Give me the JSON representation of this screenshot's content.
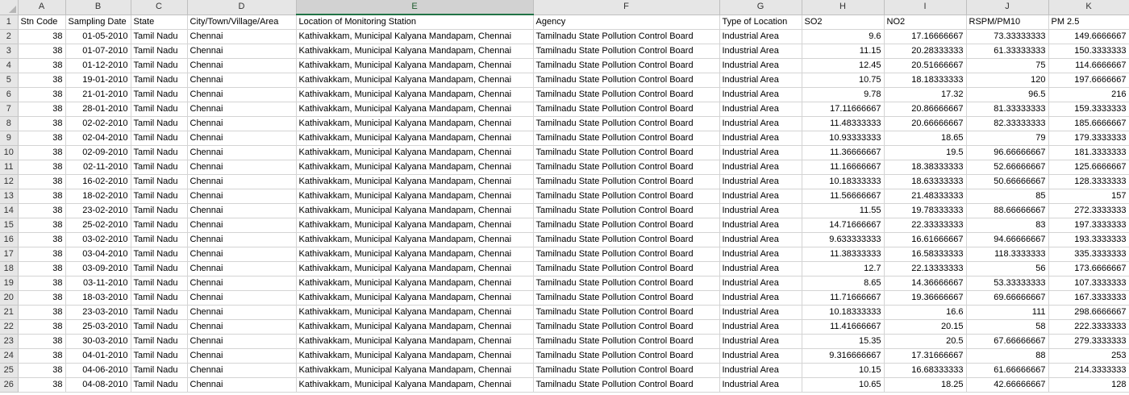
{
  "columns": [
    "A",
    "B",
    "C",
    "D",
    "E",
    "F",
    "G",
    "H",
    "I",
    "J",
    "K"
  ],
  "selected_column": "E",
  "header_row": {
    "number": "1",
    "cells": [
      "Stn Code",
      "Sampling Date",
      "State",
      "City/Town/Village/Area",
      "Location of Monitoring Station",
      "Agency",
      "Type of Location",
      "SO2",
      "NO2",
      "RSPM/PM10",
      "PM 2.5"
    ]
  },
  "rows": [
    {
      "number": "2",
      "cells": [
        "38",
        "01-05-2010",
        "Tamil Nadu",
        "Chennai",
        "Kathivakkam, Municipal Kalyana Mandapam, Chennai",
        "Tamilnadu State Pollution Control Board",
        "Industrial Area",
        "9.6",
        "17.16666667",
        "73.33333333",
        "149.6666667"
      ]
    },
    {
      "number": "3",
      "cells": [
        "38",
        "01-07-2010",
        "Tamil Nadu",
        "Chennai",
        "Kathivakkam, Municipal Kalyana Mandapam, Chennai",
        "Tamilnadu State Pollution Control Board",
        "Industrial Area",
        "11.15",
        "20.28333333",
        "61.33333333",
        "150.3333333"
      ]
    },
    {
      "number": "4",
      "cells": [
        "38",
        "01-12-2010",
        "Tamil Nadu",
        "Chennai",
        "Kathivakkam, Municipal Kalyana Mandapam, Chennai",
        "Tamilnadu State Pollution Control Board",
        "Industrial Area",
        "12.45",
        "20.51666667",
        "75",
        "114.6666667"
      ]
    },
    {
      "number": "5",
      "cells": [
        "38",
        "19-01-2010",
        "Tamil Nadu",
        "Chennai",
        "Kathivakkam, Municipal Kalyana Mandapam, Chennai",
        "Tamilnadu State Pollution Control Board",
        "Industrial Area",
        "10.75",
        "18.18333333",
        "120",
        "197.6666667"
      ]
    },
    {
      "number": "6",
      "cells": [
        "38",
        "21-01-2010",
        "Tamil Nadu",
        "Chennai",
        "Kathivakkam, Municipal Kalyana Mandapam, Chennai",
        "Tamilnadu State Pollution Control Board",
        "Industrial Area",
        "9.78",
        "17.32",
        "96.5",
        "216"
      ]
    },
    {
      "number": "7",
      "cells": [
        "38",
        "28-01-2010",
        "Tamil Nadu",
        "Chennai",
        "Kathivakkam, Municipal Kalyana Mandapam, Chennai",
        "Tamilnadu State Pollution Control Board",
        "Industrial Area",
        "17.11666667",
        "20.86666667",
        "81.33333333",
        "159.3333333"
      ]
    },
    {
      "number": "8",
      "cells": [
        "38",
        "02-02-2010",
        "Tamil Nadu",
        "Chennai",
        "Kathivakkam, Municipal Kalyana Mandapam, Chennai",
        "Tamilnadu State Pollution Control Board",
        "Industrial Area",
        "11.48333333",
        "20.66666667",
        "82.33333333",
        "185.6666667"
      ]
    },
    {
      "number": "9",
      "cells": [
        "38",
        "02-04-2010",
        "Tamil Nadu",
        "Chennai",
        "Kathivakkam, Municipal Kalyana Mandapam, Chennai",
        "Tamilnadu State Pollution Control Board",
        "Industrial Area",
        "10.93333333",
        "18.65",
        "79",
        "179.3333333"
      ]
    },
    {
      "number": "10",
      "cells": [
        "38",
        "02-09-2010",
        "Tamil Nadu",
        "Chennai",
        "Kathivakkam, Municipal Kalyana Mandapam, Chennai",
        "Tamilnadu State Pollution Control Board",
        "Industrial Area",
        "11.36666667",
        "19.5",
        "96.66666667",
        "181.3333333"
      ]
    },
    {
      "number": "11",
      "cells": [
        "38",
        "02-11-2010",
        "Tamil Nadu",
        "Chennai",
        "Kathivakkam, Municipal Kalyana Mandapam, Chennai",
        "Tamilnadu State Pollution Control Board",
        "Industrial Area",
        "11.16666667",
        "18.38333333",
        "52.66666667",
        "125.6666667"
      ]
    },
    {
      "number": "12",
      "cells": [
        "38",
        "16-02-2010",
        "Tamil Nadu",
        "Chennai",
        "Kathivakkam, Municipal Kalyana Mandapam, Chennai",
        "Tamilnadu State Pollution Control Board",
        "Industrial Area",
        "10.18333333",
        "18.63333333",
        "50.66666667",
        "128.3333333"
      ]
    },
    {
      "number": "13",
      "cells": [
        "38",
        "18-02-2010",
        "Tamil Nadu",
        "Chennai",
        "Kathivakkam, Municipal Kalyana Mandapam, Chennai",
        "Tamilnadu State Pollution Control Board",
        "Industrial Area",
        "11.56666667",
        "21.48333333",
        "85",
        "157"
      ]
    },
    {
      "number": "14",
      "cells": [
        "38",
        "23-02-2010",
        "Tamil Nadu",
        "Chennai",
        "Kathivakkam, Municipal Kalyana Mandapam, Chennai",
        "Tamilnadu State Pollution Control Board",
        "Industrial Area",
        "11.55",
        "19.78333333",
        "88.66666667",
        "272.3333333"
      ]
    },
    {
      "number": "15",
      "cells": [
        "38",
        "25-02-2010",
        "Tamil Nadu",
        "Chennai",
        "Kathivakkam, Municipal Kalyana Mandapam, Chennai",
        "Tamilnadu State Pollution Control Board",
        "Industrial Area",
        "14.71666667",
        "22.33333333",
        "83",
        "197.3333333"
      ]
    },
    {
      "number": "16",
      "cells": [
        "38",
        "03-02-2010",
        "Tamil Nadu",
        "Chennai",
        "Kathivakkam, Municipal Kalyana Mandapam, Chennai",
        "Tamilnadu State Pollution Control Board",
        "Industrial Area",
        "9.633333333",
        "16.61666667",
        "94.66666667",
        "193.3333333"
      ]
    },
    {
      "number": "17",
      "cells": [
        "38",
        "03-04-2010",
        "Tamil Nadu",
        "Chennai",
        "Kathivakkam, Municipal Kalyana Mandapam, Chennai",
        "Tamilnadu State Pollution Control Board",
        "Industrial Area",
        "11.38333333",
        "16.58333333",
        "118.3333333",
        "335.3333333"
      ]
    },
    {
      "number": "18",
      "cells": [
        "38",
        "03-09-2010",
        "Tamil Nadu",
        "Chennai",
        "Kathivakkam, Municipal Kalyana Mandapam, Chennai",
        "Tamilnadu State Pollution Control Board",
        "Industrial Area",
        "12.7",
        "22.13333333",
        "56",
        "173.6666667"
      ]
    },
    {
      "number": "19",
      "cells": [
        "38",
        "03-11-2010",
        "Tamil Nadu",
        "Chennai",
        "Kathivakkam, Municipal Kalyana Mandapam, Chennai",
        "Tamilnadu State Pollution Control Board",
        "Industrial Area",
        "8.65",
        "14.36666667",
        "53.33333333",
        "107.3333333"
      ]
    },
    {
      "number": "20",
      "cells": [
        "38",
        "18-03-2010",
        "Tamil Nadu",
        "Chennai",
        "Kathivakkam, Municipal Kalyana Mandapam, Chennai",
        "Tamilnadu State Pollution Control Board",
        "Industrial Area",
        "11.71666667",
        "19.36666667",
        "69.66666667",
        "167.3333333"
      ]
    },
    {
      "number": "21",
      "cells": [
        "38",
        "23-03-2010",
        "Tamil Nadu",
        "Chennai",
        "Kathivakkam, Municipal Kalyana Mandapam, Chennai",
        "Tamilnadu State Pollution Control Board",
        "Industrial Area",
        "10.18333333",
        "16.6",
        "111",
        "298.6666667"
      ]
    },
    {
      "number": "22",
      "cells": [
        "38",
        "25-03-2010",
        "Tamil Nadu",
        "Chennai",
        "Kathivakkam, Municipal Kalyana Mandapam, Chennai",
        "Tamilnadu State Pollution Control Board",
        "Industrial Area",
        "11.41666667",
        "20.15",
        "58",
        "222.3333333"
      ]
    },
    {
      "number": "23",
      "cells": [
        "38",
        "30-03-2010",
        "Tamil Nadu",
        "Chennai",
        "Kathivakkam, Municipal Kalyana Mandapam, Chennai",
        "Tamilnadu State Pollution Control Board",
        "Industrial Area",
        "15.35",
        "20.5",
        "67.66666667",
        "279.3333333"
      ]
    },
    {
      "number": "24",
      "cells": [
        "38",
        "04-01-2010",
        "Tamil Nadu",
        "Chennai",
        "Kathivakkam, Municipal Kalyana Mandapam, Chennai",
        "Tamilnadu State Pollution Control Board",
        "Industrial Area",
        "9.316666667",
        "17.31666667",
        "88",
        "253"
      ]
    },
    {
      "number": "25",
      "cells": [
        "38",
        "04-06-2010",
        "Tamil Nadu",
        "Chennai",
        "Kathivakkam, Municipal Kalyana Mandapam, Chennai",
        "Tamilnadu State Pollution Control Board",
        "Industrial Area",
        "10.15",
        "16.68333333",
        "61.66666667",
        "214.3333333"
      ]
    },
    {
      "number": "26",
      "cells": [
        "38",
        "04-08-2010",
        "Tamil Nadu",
        "Chennai",
        "Kathivakkam, Municipal Kalyana Mandapam, Chennai",
        "Tamilnadu State Pollution Control Board",
        "Industrial Area",
        "10.65",
        "18.25",
        "42.66666667",
        "128"
      ]
    }
  ]
}
